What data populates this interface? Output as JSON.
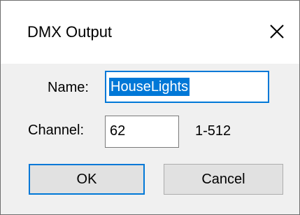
{
  "window": {
    "title": "DMX Output",
    "close_icon": "close-icon"
  },
  "form": {
    "name_label": "Name:",
    "name_value": "HouseLights",
    "channel_label": "Channel:",
    "channel_value": "62",
    "channel_range": "1-512"
  },
  "buttons": {
    "ok_label": "OK",
    "cancel_label": "Cancel"
  },
  "colors": {
    "accent": "#0078d7",
    "dialog_bg": "#f0f0f0",
    "button_bg": "#e1e1e1"
  }
}
